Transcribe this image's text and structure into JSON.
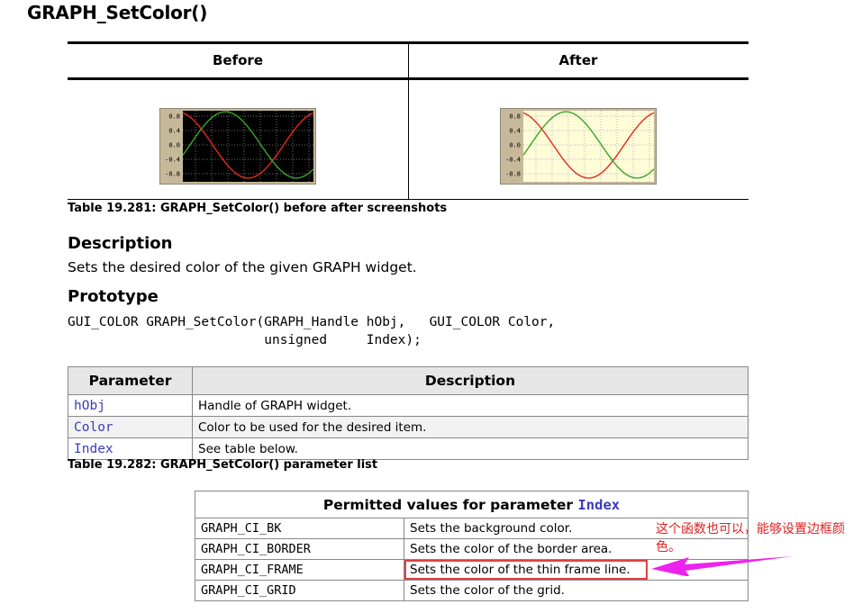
{
  "title": "GRAPH_SetColor()",
  "screens": {
    "before_header": "Before",
    "after_header": "After",
    "tick_labels": [
      "0.8",
      "0.4",
      "0.0",
      "-0.4",
      "-0.8"
    ],
    "before_colors": {
      "background": "#000000",
      "grid": "#6b6b6b",
      "frame": "#c6b99a"
    },
    "after_colors": {
      "background": "#fffcd8",
      "grid": "#b8b8b8",
      "frame": "#c6b99a"
    },
    "curve_colors": {
      "red": "#e8261e",
      "green": "#3aa52a"
    }
  },
  "caption1": "Table 19.281: GRAPH_SetColor() before after screenshots",
  "description_heading": "Description",
  "description_text": "Sets the desired color of the given GRAPH widget.",
  "prototype_heading": "Prototype",
  "prototype": {
    "line1": "GUI_COLOR GRAPH_SetColor(GRAPH_Handle hObj,   GUI_COLOR Color,",
    "line2": "                         unsigned     Index);"
  },
  "param_table": {
    "headers": [
      "Parameter",
      "Description"
    ],
    "rows": [
      {
        "name": "hObj",
        "desc": "Handle of GRAPH widget."
      },
      {
        "name": "Color",
        "desc": "Color to be used for the desired item."
      },
      {
        "name": "Index",
        "desc": "See table below."
      }
    ]
  },
  "caption2": "Table 19.282: GRAPH_SetColor() parameter list",
  "values_table": {
    "header_text": "Permitted values for parameter",
    "header_param": "Index",
    "rows": [
      {
        "key": "GRAPH_CI_BK",
        "desc": "Sets the background color."
      },
      {
        "key": "GRAPH_CI_BORDER",
        "desc": "Sets the color of the border area."
      },
      {
        "key": "GRAPH_CI_FRAME",
        "desc": "Sets the color of the thin frame line."
      },
      {
        "key": "GRAPH_CI_GRID",
        "desc": "Sets the color of the grid."
      }
    ]
  },
  "annotation": {
    "text": "这个函数也可以，能够设置边框颜色。",
    "color": "#e02020",
    "arrow_color": "#ee22ee"
  }
}
